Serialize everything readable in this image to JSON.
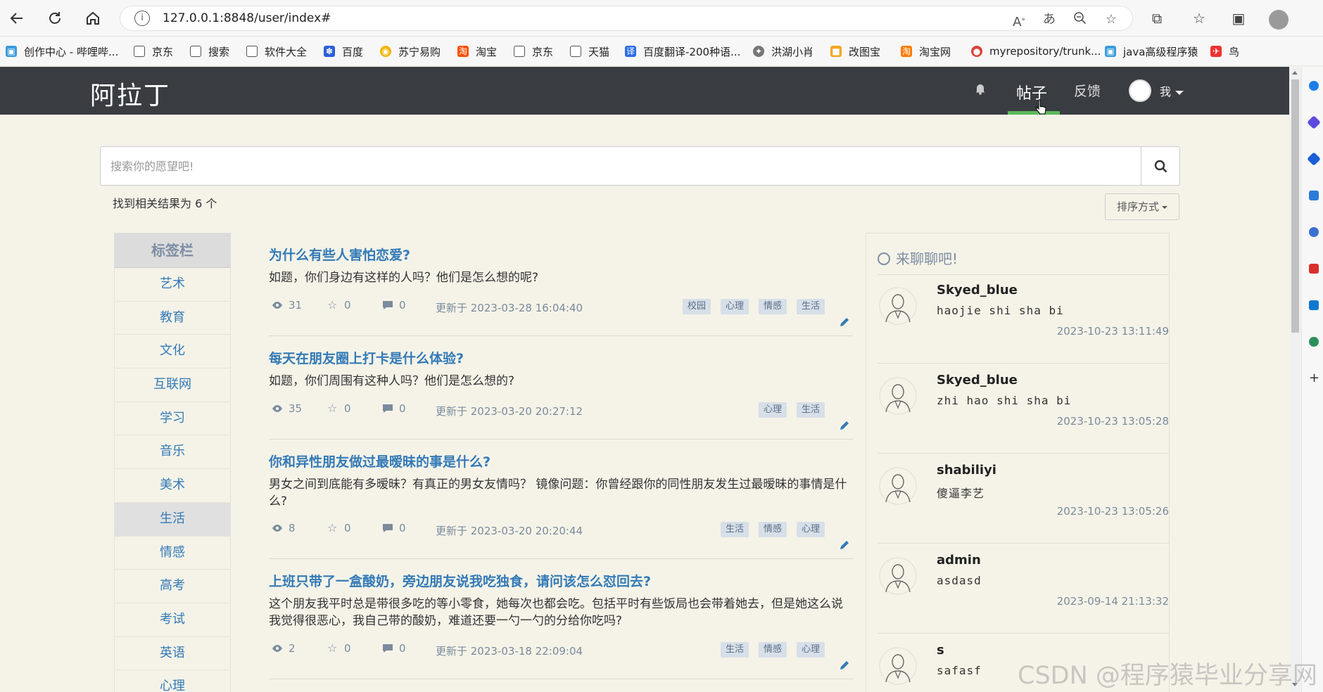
{
  "browser": {
    "url": "127.0.0.1:8848/user/index#",
    "bookmarks": [
      {
        "label": "创作中心 - 哔哩哔...",
        "icon": "bilibili-icon"
      },
      {
        "label": "京东",
        "icon": "page-icon"
      },
      {
        "label": "搜索",
        "icon": "page-icon"
      },
      {
        "label": "软件大全",
        "icon": "page-icon"
      },
      {
        "label": "百度",
        "icon": "baidu-icon"
      },
      {
        "label": "苏宁易购",
        "icon": "suning-icon"
      },
      {
        "label": "淘宝",
        "icon": "taobao-icon"
      },
      {
        "label": "京东",
        "icon": "page-icon"
      },
      {
        "label": "天猫",
        "icon": "page-icon"
      },
      {
        "label": "百度翻译-200种语...",
        "icon": "baidu-translate-icon"
      },
      {
        "label": "洪湖小肖",
        "icon": "honghu-icon"
      },
      {
        "label": "改图宝",
        "icon": "gaitubao-icon"
      },
      {
        "label": "淘宝网",
        "icon": "taobao-icon"
      },
      {
        "label": "myrepository/trunk...",
        "icon": "chrome-icon"
      },
      {
        "label": "java高级程序猿",
        "icon": "bilibili-icon"
      },
      {
        "label": "鸟",
        "icon": "bird-icon"
      }
    ]
  },
  "nav": {
    "logo": "阿拉丁",
    "posts": "帖子",
    "feedback": "反馈",
    "me": "我"
  },
  "search": {
    "placeholder": "搜索你的愿望吧!",
    "result_count": "找到相关结果为 6 个",
    "sort_label": "排序方式"
  },
  "sidebar": {
    "title": "标签栏",
    "tags": [
      "艺术",
      "教育",
      "文化",
      "互联网",
      "学习",
      "音乐",
      "美术",
      "生活",
      "情感",
      "高考",
      "考试",
      "英语",
      "心理"
    ],
    "active_tag": "生活"
  },
  "posts": [
    {
      "title": "为什么有些人害怕恋爱?",
      "desc": "如题，你们身边有这样的人吗？他们是怎么想的呢?",
      "views": "31",
      "stars": "0",
      "comments": "0",
      "updated": "更新于 2023-03-28 16:04:40",
      "tags": [
        "校园",
        "心理",
        "情感",
        "生活"
      ]
    },
    {
      "title": "每天在朋友圈上打卡是什么体验?",
      "desc": "如题，你们周围有这种人吗？他们是怎么想的?",
      "views": "35",
      "stars": "0",
      "comments": "0",
      "updated": "更新于 2023-03-20 20:27:12",
      "tags": [
        "心理",
        "生活"
      ]
    },
    {
      "title": "你和异性朋友做过最暧昧的事是什么?",
      "desc": "男女之间到底能有多暧昧？有真正的男女友情吗？ 镜像问题：你曾经跟你的同性朋友发生过最暧昧的事情是什么?",
      "views": "8",
      "stars": "0",
      "comments": "0",
      "updated": "更新于 2023-03-20 20:20:44",
      "tags": [
        "生活",
        "情感",
        "心理"
      ]
    },
    {
      "title": "上班只带了一盒酸奶，旁边朋友说我吃独食，请问该怎么怼回去?",
      "desc": "这个朋友我平时总是带很多吃的等小零食，她每次也都会吃。包括平时有些饭局也会带着她去，但是她这么说我觉得很恶心，我自己带的酸奶，难道还要一勺一勺的分给你吃吗?",
      "views": "2",
      "stars": "0",
      "comments": "0",
      "updated": "更新于 2023-03-18 22:09:04",
      "tags": [
        "生活",
        "情感",
        "心理"
      ]
    }
  ],
  "chat": {
    "title": "来聊聊吧!",
    "messages": [
      {
        "user": "Skyed_blue",
        "text": "haojie shi sha bi",
        "time": "2023-10-23 13:11:49"
      },
      {
        "user": "Skyed_blue",
        "text": "zhi hao shi sha bi",
        "time": "2023-10-23 13:05:28"
      },
      {
        "user": "shabiliyi",
        "text": "傻逼李艺",
        "time": "2023-10-23 13:05:26"
      },
      {
        "user": "admin",
        "text": "asdasd",
        "time": "2023-09-14 21:13:32"
      },
      {
        "user": "s",
        "text": "safasf",
        "time": ""
      }
    ]
  },
  "watermark": "CSDN @程序猿毕业分享网",
  "colors": {
    "nav_bg": "#393d42",
    "page_bg": "#f5f3e8",
    "link": "#337ab7",
    "active_underline": "#5cb85c",
    "tag_bg": "#d7dfe8"
  }
}
